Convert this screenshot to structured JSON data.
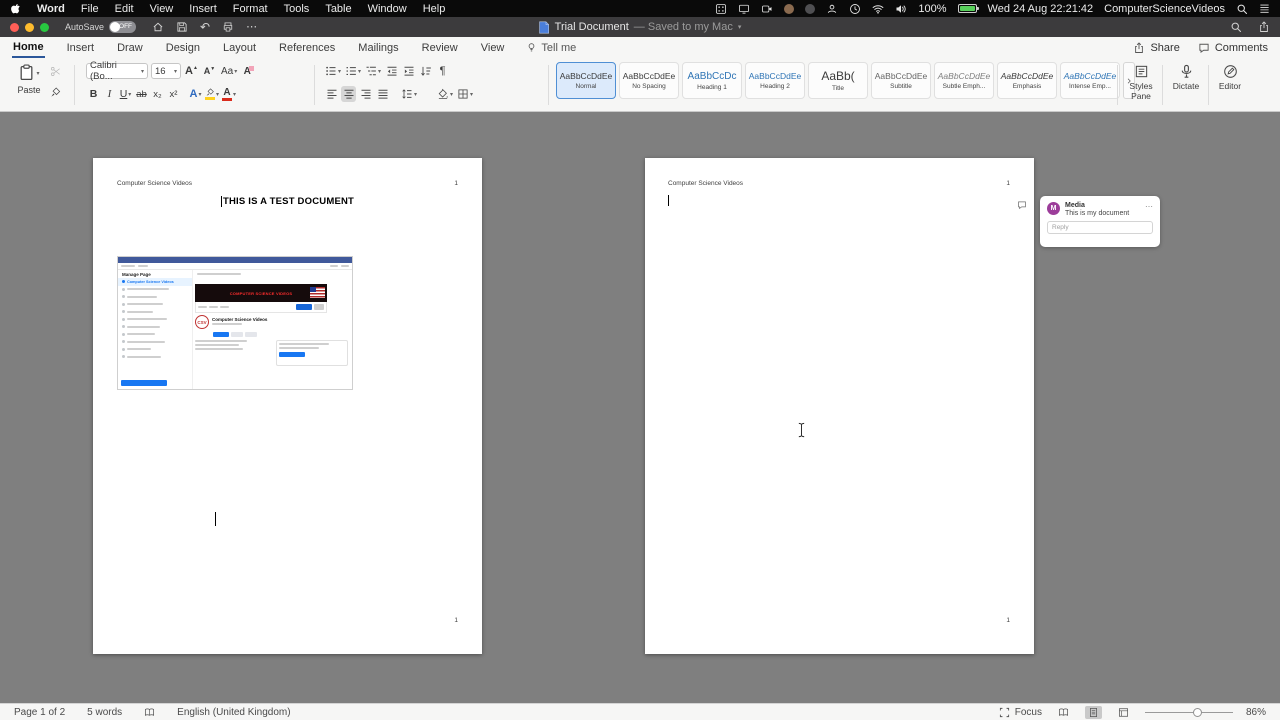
{
  "icons": {
    "chevron_down": "▾",
    "ellipsis": "⋯",
    "undo": "↶",
    "pilcrow": "¶"
  },
  "menubar": {
    "items": [
      "Word",
      "File",
      "Edit",
      "View",
      "Insert",
      "Format",
      "Tools",
      "Table",
      "Window",
      "Help"
    ],
    "battery_percent": "100%",
    "datetime": "Wed 24 Aug 22:21:42",
    "account": "ComputerScienceVideos"
  },
  "titlebar": {
    "autosave_label": "AutoSave",
    "autosave_state": "OFF",
    "doc_title": "Trial Document",
    "saved_status": "— Saved to my Mac"
  },
  "ribbon": {
    "tabs": [
      "Home",
      "Insert",
      "Draw",
      "Design",
      "Layout",
      "References",
      "Mailings",
      "Review",
      "View"
    ],
    "tellme_label": "Tell me",
    "share_label": "Share",
    "comments_label": "Comments",
    "paste_label": "Paste",
    "font_name": "Calibri (Bo...",
    "font_size": "16",
    "grow_font": "A",
    "shrink_font": "A",
    "change_case": "Aa",
    "clear_format": "A",
    "bold": "B",
    "italic": "I",
    "underline": "U",
    "strikethrough": "ab",
    "subscript": "x₂",
    "superscript": "x²",
    "text_effects": "A",
    "font_color": "A",
    "styles": [
      {
        "sample": "AaBbCcDdEe",
        "name": "Normal"
      },
      {
        "sample": "AaBbCcDdEe",
        "name": "No Spacing"
      },
      {
        "sample": "AaBbCcDc",
        "name": "Heading 1"
      },
      {
        "sample": "AaBbCcDdEe",
        "name": "Heading 2"
      },
      {
        "sample": "AaBb(",
        "name": "Title"
      },
      {
        "sample": "AaBbCcDdEe",
        "name": "Subtitle"
      },
      {
        "sample": "AaBbCcDdEe",
        "name": "Subtle Emph..."
      },
      {
        "sample": "AaBbCcDdEe",
        "name": "Emphasis"
      },
      {
        "sample": "AaBbCcDdEe",
        "name": "Intense Emp..."
      }
    ],
    "styles_pane_label": "Styles Pane",
    "dictate_label": "Dictate",
    "editor_label": "Editor"
  },
  "pages": {
    "page1": {
      "header": "Computer Science Videos",
      "page_number": "1",
      "title": "THIS IS A TEST DOCUMENT",
      "footer_number": "1"
    },
    "page2": {
      "header": "Computer Science Videos",
      "page_number": "1",
      "footer_number": "1"
    }
  },
  "embedded_screenshot": {
    "sidebar_title": "Manage Page",
    "sidebar_selected": "Computer Science Videos",
    "banner_title": "COMPUTER SCIENCE VIDEOS",
    "logo_text": "CSV",
    "page_name": "Computer Science Videos"
  },
  "comment_card": {
    "author": "Media",
    "avatar_initial": "M",
    "body": "This is my document",
    "reply_placeholder": "Reply",
    "menu": "⋯"
  },
  "statusbar": {
    "page_indicator": "Page 1 of 2",
    "word_count": "5 words",
    "language": "English (United Kingdom)",
    "focus_label": "Focus",
    "zoom_level": "86%"
  }
}
